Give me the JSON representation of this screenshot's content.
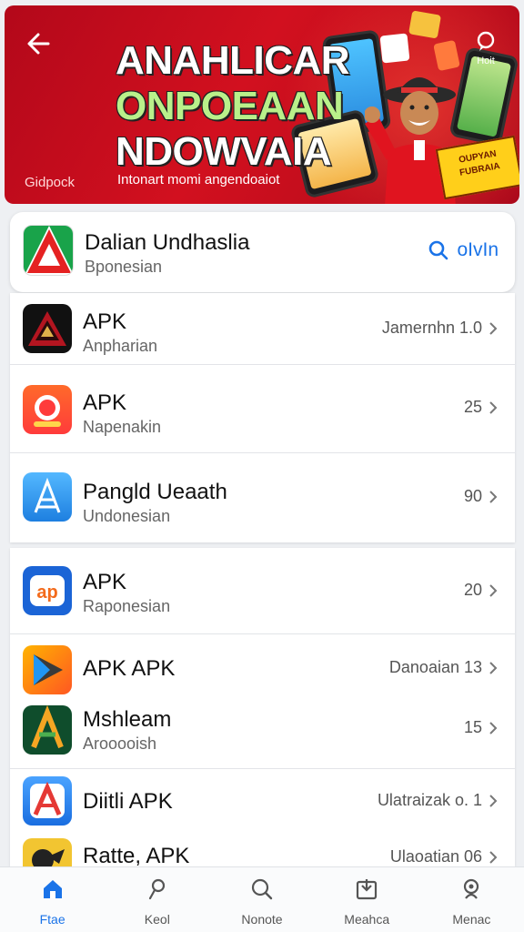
{
  "banner": {
    "headline_line1": "ANAHLICAR",
    "headline_line2": "ONPOEAAN",
    "headline_line3": "NDOWVAIA",
    "subtitle": "Intonart momi angendoaiot",
    "brand": "Gidpock",
    "corner_label": "Hoit",
    "sticker_text": "OUPYAN FUBRAIA",
    "accent": "#d2101f"
  },
  "search_card": {
    "title": "Dalian Undhaslia",
    "subtitle": "Bponesian",
    "action_label": "oIvIn",
    "icon": "search-icon"
  },
  "list_group_1": [
    {
      "title": "APK",
      "subtitle": "Anpharian",
      "meta": "Jamernhn 1.0"
    },
    {
      "title": "APK",
      "subtitle": "Napenakin",
      "meta": "25"
    },
    {
      "title": "Pangld Ueaath",
      "subtitle": "Undonesian",
      "meta": "90"
    }
  ],
  "list_group_2": [
    {
      "title": "APK",
      "subtitle": "Raponesian",
      "meta": "20"
    },
    {
      "title": "APK APK",
      "subtitle": "",
      "meta": "Danoaian 13"
    },
    {
      "title": "Mshleam",
      "subtitle": "Arooooish",
      "meta": "15"
    },
    {
      "title": "Diitli APK",
      "subtitle": "",
      "meta": "Ulatraizak o. 1"
    },
    {
      "title": "Ratte, APK",
      "subtitle": "",
      "meta": "Ulaoatian 06"
    }
  ],
  "bottom_nav": [
    {
      "label": "Ftae",
      "icon": "home-icon"
    },
    {
      "label": "Keol",
      "icon": "person-icon"
    },
    {
      "label": "Nonote",
      "icon": "search-icon"
    },
    {
      "label": "Meahca",
      "icon": "download-icon"
    },
    {
      "label": "Menac",
      "icon": "settings-icon"
    }
  ],
  "colors": {
    "link": "#1a73e8",
    "divider": "#e2e4e8"
  }
}
